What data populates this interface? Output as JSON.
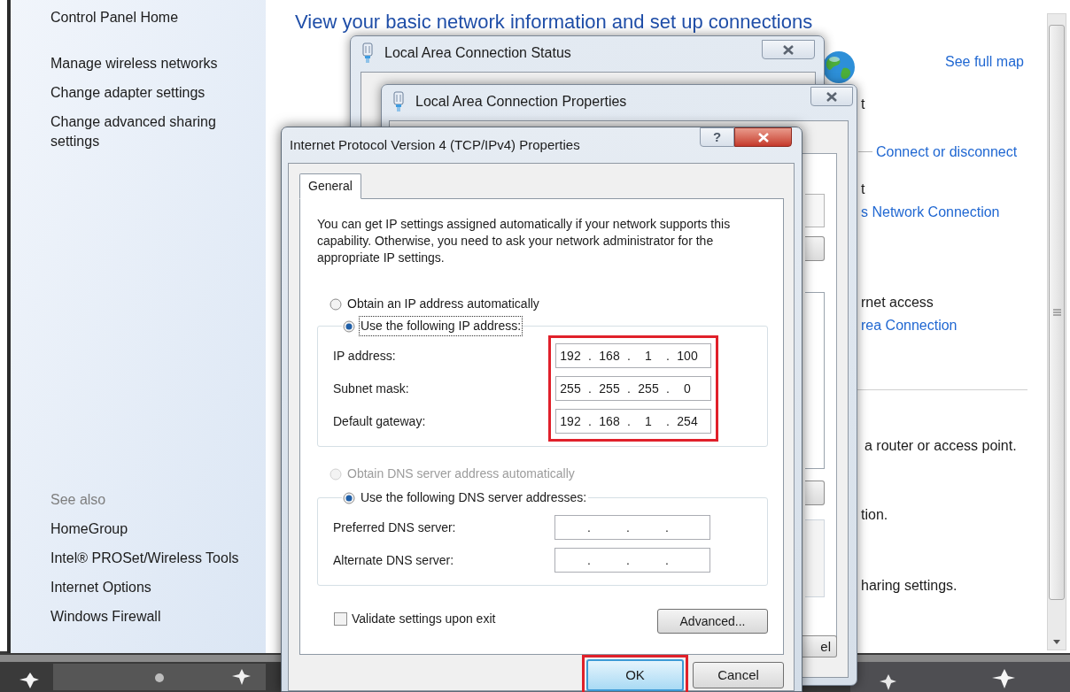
{
  "control_panel": {
    "sidebar": {
      "home": "Control Panel Home",
      "tasks": [
        "Manage wireless networks",
        "Change adapter settings",
        "Change advanced sharing settings"
      ],
      "see_also_heading": "See also",
      "see_also": [
        "HomeGroup",
        "Intel® PROSet/Wireless Tools",
        "Internet Options",
        "Windows Firewall"
      ]
    },
    "heading": "View your basic network information and set up connections",
    "main_texts": [
      {
        "text": "See full map",
        "kind": "link"
      },
      {
        "text": "t",
        "kind": "plain"
      },
      {
        "text": "Connect or disconnect",
        "kind": "link"
      },
      {
        "text": "t",
        "kind": "plain"
      },
      {
        "text": "s Network Connection",
        "kind": "link"
      },
      {
        "text": "rnet access",
        "kind": "plain"
      },
      {
        "text": "rea Connection",
        "kind": "link"
      },
      {
        "text": "a router or access point.",
        "kind": "plain"
      },
      {
        "text": "tion.",
        "kind": "plain"
      },
      {
        "text": "haring settings.",
        "kind": "plain"
      }
    ]
  },
  "status_window": {
    "title": "Local Area Connection Status"
  },
  "properties_window": {
    "title": "Local Area Connection Properties",
    "cancel_button": "el"
  },
  "ipv4_dialog": {
    "title": "Internet Protocol Version 4 (TCP/IPv4) Properties",
    "help_button": "?",
    "tabs": [
      {
        "label": "General",
        "selected": true
      }
    ],
    "description": "You can get IP settings assigned automatically if your network supports this capability. Otherwise, you need to ask your network administrator for the appropriate IP settings.",
    "ip_options": [
      {
        "label": "Obtain an IP address automatically",
        "selected": false,
        "disabled": false,
        "focused": false
      },
      {
        "label": "Use the following IP address:",
        "selected": true,
        "disabled": false,
        "focused": true
      }
    ],
    "ip_fields_highlighted": true,
    "ip_fields": [
      {
        "label": "IP address:",
        "segments": [
          "192",
          ".",
          "168",
          ".",
          "1",
          ".",
          "100"
        ]
      },
      {
        "label": "Subnet mask:",
        "segments": [
          "255",
          ".",
          "255",
          ".",
          "255",
          ".",
          "0"
        ]
      },
      {
        "label": "Default gateway:",
        "segments": [
          "192",
          ".",
          "168",
          ".",
          "1",
          ".",
          "254"
        ]
      }
    ],
    "dns_options": [
      {
        "label": "Obtain DNS server address automatically",
        "selected": false,
        "disabled": true
      },
      {
        "label": "Use the following DNS server addresses:",
        "selected": true,
        "disabled": false
      }
    ],
    "dns_fields": [
      {
        "label": "Preferred DNS server:",
        "segments": [
          ".",
          ".",
          "."
        ]
      },
      {
        "label": "Alternate DNS server:",
        "segments": [
          ".",
          ".",
          "."
        ]
      }
    ],
    "validate": {
      "label": "Validate settings upon exit",
      "checked": false
    },
    "advanced_button": "Advanced...",
    "ok_button": {
      "label": "OK",
      "highlighted": true
    },
    "cancel_button": "Cancel"
  }
}
